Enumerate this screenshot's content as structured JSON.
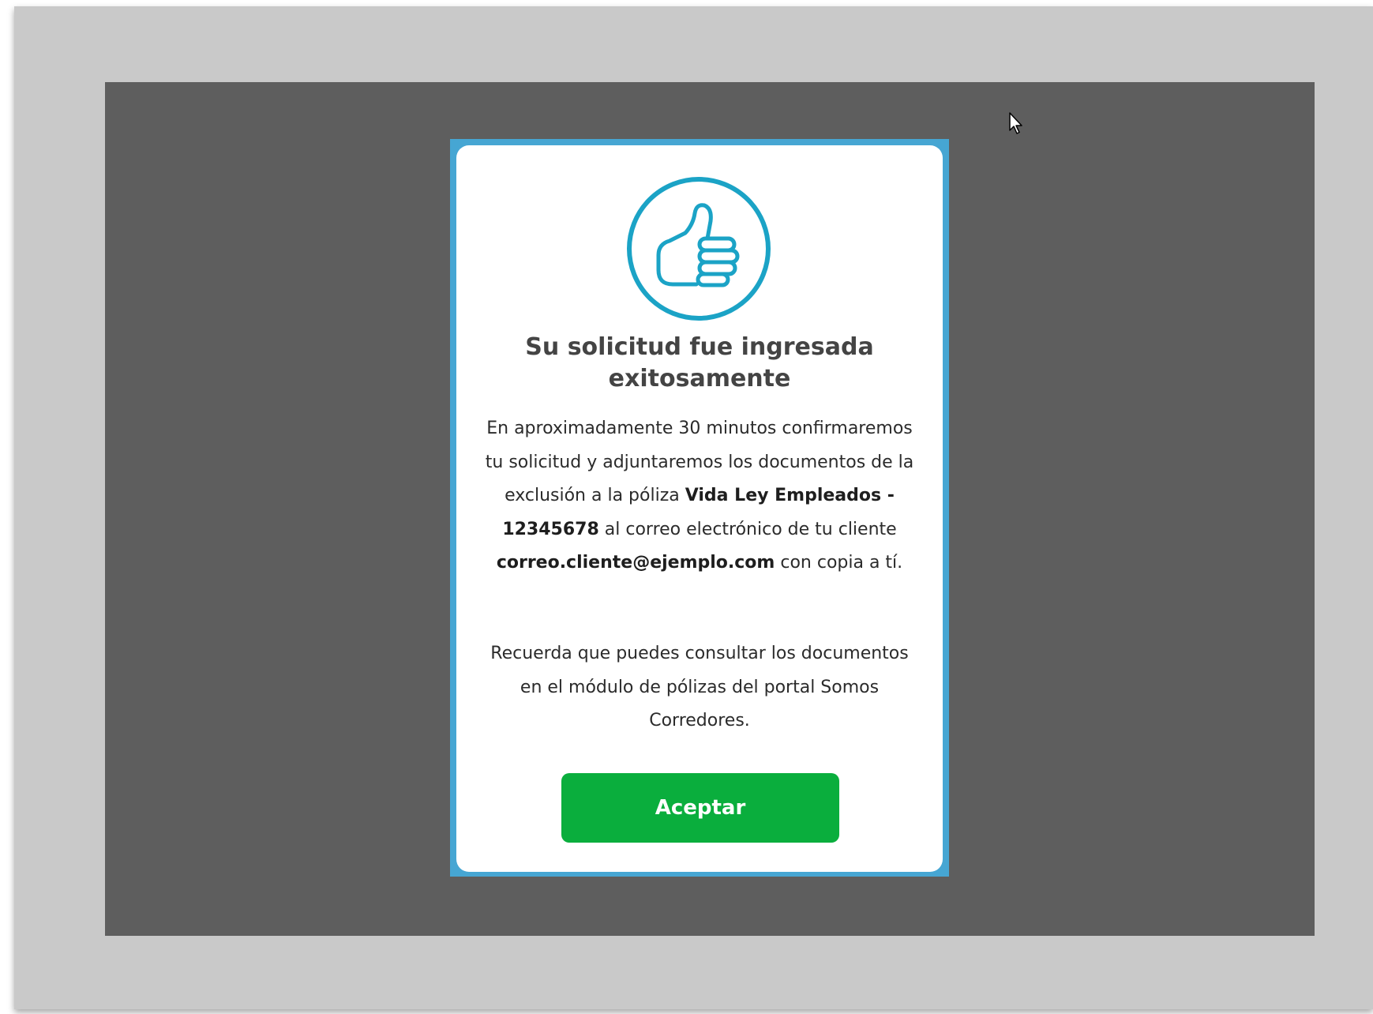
{
  "modal": {
    "icon": "thumbs-up-icon",
    "title": "Su solicitud fue ingresada exitosamente",
    "message": {
      "part1": "En aproximadamente 30 minutos confirmaremos tu solicitud y adjuntaremos los documentos de la exclusión a la póliza",
      "policy": "Vida Ley Empleados - 12345678",
      "part2": "al correo electrónico de tu cliente",
      "email": "correo.cliente@ejemplo.com",
      "part3": "con copia a tí."
    },
    "reminder": "Recuerda que puedes consultar los documentos en el módulo de pólizas del portal Somos Corredores.",
    "accept_label": "Aceptar"
  },
  "colors": {
    "accent": "#1ba3c6",
    "button": "#0aae3d",
    "modal_border": "#46a6d3",
    "overlay": "#5e5e5e"
  }
}
